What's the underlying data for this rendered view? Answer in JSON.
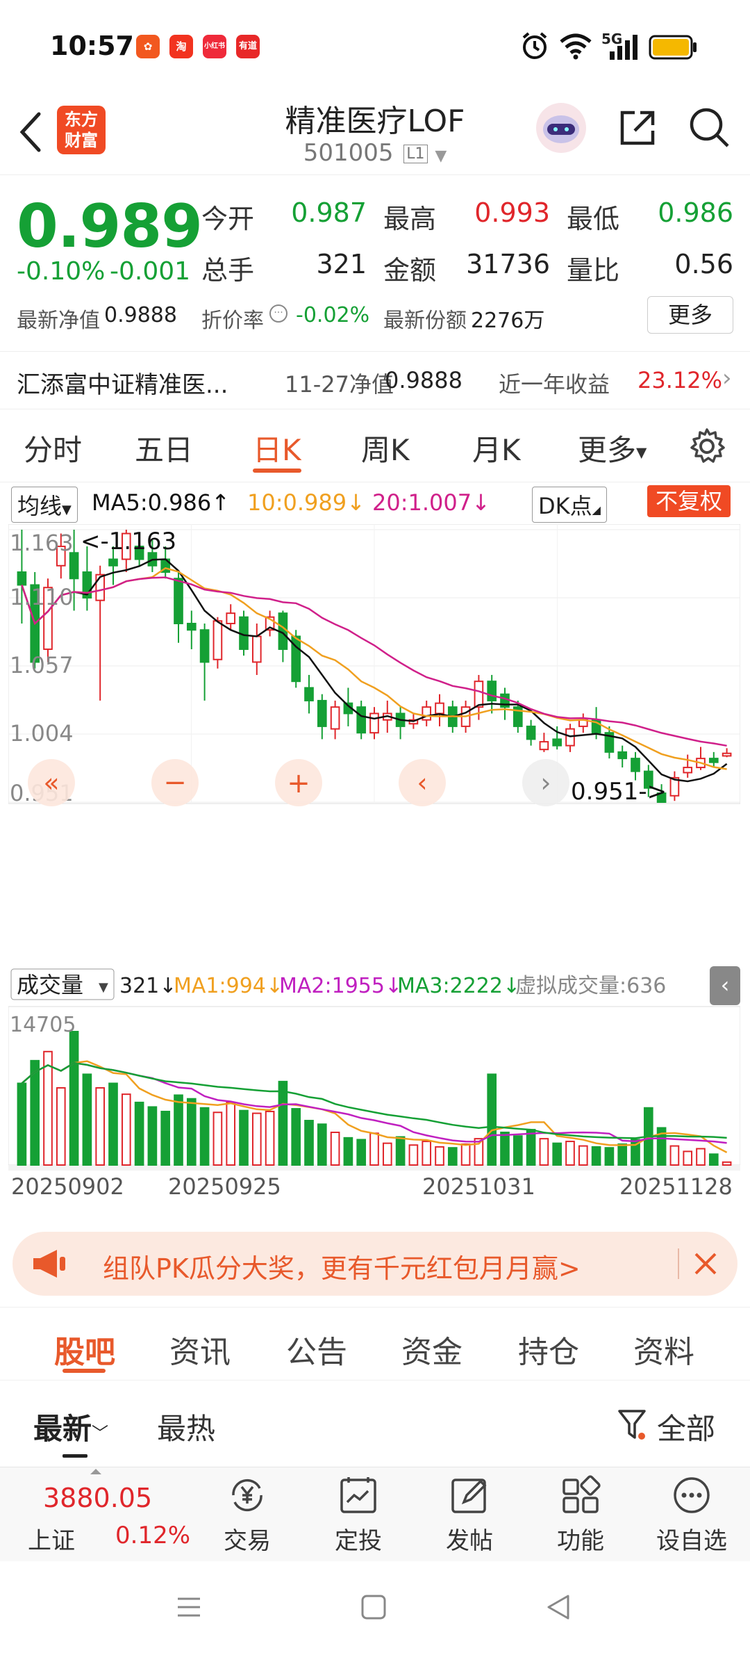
{
  "status_bar": {
    "time": "10:57",
    "network": "5G",
    "app_icons": [
      {
        "name": "app-icon-1",
        "text": "",
        "color": "#f2581f"
      },
      {
        "name": "app-icon-2",
        "text": "淘",
        "color": "#f2331f"
      },
      {
        "name": "app-icon-3",
        "text": "小红书",
        "color": "#ef2a3a"
      },
      {
        "name": "app-icon-4",
        "text": "有道",
        "color": "#e82828"
      }
    ]
  },
  "header": {
    "logo_text_1": "东方",
    "logo_text_2": "财富",
    "title": "精准医疗LOF",
    "code": "501005",
    "level": "L1"
  },
  "quote": {
    "price": "0.989",
    "change_pct": "-0.10%",
    "change": "-0.001",
    "open_label": "今开",
    "open": "0.987",
    "high_label": "最高",
    "high": "0.993",
    "low_label": "最低",
    "low": "0.986",
    "vol_label": "总手",
    "vol": "321",
    "amount_label": "金额",
    "amount": "31736",
    "ratio_label": "量比",
    "ratio": "0.56",
    "nav_label": "最新净值",
    "nav": "0.9888",
    "discount_label": "折价率",
    "discount": "-0.02%",
    "shares_label": "最新份额",
    "shares": "2276万",
    "more_btn": "更多"
  },
  "fund_row": {
    "name": "汇添富中证精准医...",
    "nav_date_label": "11-27净值",
    "nav_value": "0.9888",
    "return_label": "近一年收益",
    "return_value": "23.12%"
  },
  "chart_tabs": [
    "分时",
    "五日",
    "日K",
    "周K",
    "月K",
    "更多"
  ],
  "ma_row": {
    "indicator": "均线",
    "ma5": "MA5:0.986↑",
    "ma10": "10:0.989↓",
    "ma20": "20:1.007↓",
    "dk": "DK点",
    "adjust": "不复权"
  },
  "kchart_labels": {
    "y_ticks": [
      "1.163",
      "1.110",
      "1.057",
      "1.004",
      "0.951"
    ],
    "max_label": "<-1.163",
    "min_label": "0.951->"
  },
  "vol_row": {
    "indicator": "成交量",
    "vol": "321↓",
    "ma1": "MA1:994↓",
    "ma2": "MA2:1955↓",
    "ma3": "MA3:2222↓",
    "virtual": "虚拟成交量:636",
    "max_tick": "14705"
  },
  "x_dates": [
    "20250902",
    "20250925",
    "20251031",
    "20251128"
  ],
  "colors": {
    "up": "#e0262b",
    "down": "#15a035",
    "ma5": "#111111",
    "ma10": "#f0a020",
    "ma20": "#d0208a",
    "accent": "#e8592b"
  },
  "chart_data": {
    "type": "candlestick",
    "ylim": [
      0.951,
      1.163
    ],
    "candles": [
      [
        1.13,
        1.12,
        1.163,
        1.09
      ],
      [
        1.12,
        1.06,
        1.13,
        1.055
      ],
      [
        1.07,
        1.118,
        1.125,
        1.06
      ],
      [
        1.135,
        1.15,
        1.16,
        1.125
      ],
      [
        1.145,
        1.125,
        1.163,
        1.1
      ],
      [
        1.13,
        1.11,
        1.15,
        1.1
      ],
      [
        1.108,
        1.128,
        1.135,
        1.03
      ],
      [
        1.14,
        1.135,
        1.15,
        1.12
      ],
      [
        1.14,
        1.16,
        1.163,
        1.13
      ],
      [
        1.15,
        1.14,
        1.16,
        1.135
      ],
      [
        1.145,
        1.135,
        1.155,
        1.13
      ],
      [
        1.14,
        1.13,
        1.15,
        1.125
      ],
      [
        1.125,
        1.09,
        1.13,
        1.075
      ],
      [
        1.09,
        1.085,
        1.1,
        1.07
      ],
      [
        1.085,
        1.06,
        1.09,
        1.03
      ],
      [
        1.062,
        1.092,
        1.095,
        1.055
      ],
      [
        1.09,
        1.098,
        1.105,
        1.085
      ],
      [
        1.095,
        1.07,
        1.1,
        1.065
      ],
      [
        1.06,
        1.08,
        1.09,
        1.05
      ],
      [
        1.085,
        1.095,
        1.1,
        1.08
      ],
      [
        1.098,
        1.07,
        1.1,
        1.06
      ],
      [
        1.08,
        1.045,
        1.085,
        1.04
      ],
      [
        1.04,
        1.03,
        1.05,
        1.02
      ],
      [
        1.03,
        1.01,
        1.035,
        1.0
      ],
      [
        1.008,
        1.025,
        1.03,
        1.0
      ],
      [
        1.028,
        1.02,
        1.04,
        1.01
      ],
      [
        1.025,
        1.005,
        1.03,
        1.0
      ],
      [
        1.005,
        1.02,
        1.025,
        1.0
      ],
      [
        1.015,
        1.02,
        1.03,
        1.005
      ],
      [
        1.02,
        1.01,
        1.025,
        1.0
      ],
      [
        1.012,
        1.015,
        1.02,
        1.008
      ],
      [
        1.015,
        1.025,
        1.03,
        1.01
      ],
      [
        1.02,
        1.028,
        1.035,
        1.01
      ],
      [
        1.025,
        1.01,
        1.03,
        1.005
      ],
      [
        1.01,
        1.025,
        1.03,
        1.005
      ],
      [
        1.025,
        1.045,
        1.05,
        1.015
      ],
      [
        1.045,
        1.03,
        1.05,
        1.02
      ],
      [
        1.035,
        1.025,
        1.04,
        1.015
      ],
      [
        1.025,
        1.01,
        1.03,
        1.005
      ],
      [
        1.01,
        1.0,
        1.015,
        0.995
      ],
      [
        0.992,
        0.998,
        1.005,
        0.99
      ],
      [
        1.0,
        0.995,
        1.01,
        0.992
      ],
      [
        0.995,
        1.008,
        1.012,
        0.99
      ],
      [
        1.01,
        1.015,
        1.02,
        1.005
      ],
      [
        1.015,
        1.005,
        1.025,
        1.0
      ],
      [
        1.005,
        0.99,
        1.01,
        0.985
      ],
      [
        0.99,
        0.985,
        0.995,
        0.978
      ],
      [
        0.985,
        0.975,
        0.99,
        0.968
      ],
      [
        0.975,
        0.962,
        0.98,
        0.955
      ],
      [
        0.958,
        0.951,
        0.965,
        0.951
      ],
      [
        0.956,
        0.97,
        0.975,
        0.952
      ],
      [
        0.974,
        0.978,
        0.988,
        0.97
      ],
      [
        0.978,
        0.985,
        0.994,
        0.976
      ],
      [
        0.985,
        0.982,
        0.99,
        0.978
      ],
      [
        0.987,
        0.989,
        0.993,
        0.986
      ]
    ],
    "volumes": [
      9000,
      11500,
      12500,
      8500,
      14705,
      10000,
      8500,
      9000,
      7800,
      6900,
      6400,
      5900,
      7700,
      7300,
      6300,
      5800,
      6900,
      6000,
      5700,
      5900,
      9200,
      6200,
      4900,
      4500,
      3600,
      3000,
      2800,
      3500,
      2400,
      3100,
      2200,
      2600,
      2000,
      1900,
      2300,
      2900,
      10000,
      3600,
      3200,
      3900,
      2900,
      2400,
      2600,
      2100,
      2000,
      1900,
      2300,
      2800,
      6300,
      4100,
      2100,
      1500,
      1800,
      1200,
      321
    ]
  },
  "banner": {
    "text": "组队PK瓜分大奖，更有千元红包月月赢>"
  },
  "social_tabs": [
    "股吧",
    "资讯",
    "公告",
    "资金",
    "持仓",
    "资料"
  ],
  "sort_row": {
    "latest": "最新",
    "hot": "最热",
    "filter": "全部"
  },
  "bottom_nav": {
    "index_value": "3880.05",
    "index_name": "上证",
    "index_change": "0.12%",
    "items": [
      "交易",
      "定投",
      "发帖",
      "功能",
      "设自选"
    ]
  }
}
